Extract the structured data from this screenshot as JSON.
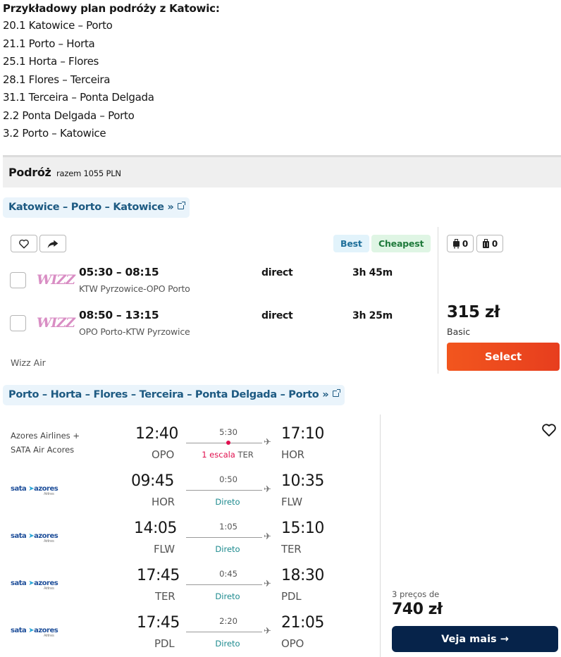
{
  "itinerary": {
    "heading": "Przykładowy plan podróży z Katowic:",
    "lines": [
      "20.1 Katowice – Porto",
      "21.1 Porto – Horta",
      "25.1 Horta – Flores",
      "28.1 Flores – Terceira",
      "31.1 Terceira – Ponta Delgada",
      "2.2 Ponta Delgada – Porto",
      "3.2 Porto – Katowice"
    ]
  },
  "trip": {
    "title": "Podróż",
    "total": "razem 1055 PLN"
  },
  "route1": {
    "link": "Katowice – Porto – Katowice »",
    "badges": {
      "best": "Best",
      "cheapest": "Cheapest"
    },
    "flights": [
      {
        "airline_logo": "WIZZ",
        "times": "05:30 – 08:15",
        "airports": "KTW Pyrzowice-OPO Porto",
        "stops": "direct",
        "duration": "3h 45m"
      },
      {
        "airline_logo": "WIZZ",
        "times": "08:50 – 13:15",
        "airports": "OPO Porto-KTW Pyrzowice",
        "stops": "direct",
        "duration": "3h 25m"
      }
    ],
    "carrier": "Wizz Air",
    "bags": {
      "cabin": "0",
      "checked": "0"
    },
    "price": "315 zł",
    "fare": "Basic",
    "select_label": "Select"
  },
  "route2": {
    "link": "Porto – Horta – Flores – Terceira – Ponta Delgada – Porto »",
    "first_carrier": [
      "Azores Airlines +",
      "SATA Air Acores"
    ],
    "logo_text": "sata",
    "logo_text2": "azores",
    "logo_sub": "Airlines",
    "legs": [
      {
        "dep": "12:40",
        "dep_code": "OPO",
        "dur": "5:30",
        "arr": "17:10",
        "arr_code": "HOR",
        "stop_count": "1 escala",
        "stop_code": "TER"
      },
      {
        "dep": "09:45",
        "dep_code": "HOR",
        "dur": "0:50",
        "arr": "10:35",
        "arr_code": "FLW",
        "stop": "Direto"
      },
      {
        "dep": "14:05",
        "dep_code": "FLW",
        "dur": "1:05",
        "arr": "15:10",
        "arr_code": "TER",
        "stop": "Direto"
      },
      {
        "dep": "17:45",
        "dep_code": "TER",
        "dur": "0:45",
        "arr": "18:30",
        "arr_code": "PDL",
        "stop": "Direto"
      },
      {
        "dep": "17:45",
        "dep_code": "PDL",
        "dur": "2:20",
        "arr": "21:05",
        "arr_code": "OPO",
        "stop": "Direto"
      }
    ],
    "price_count": "3 preços de",
    "price": "740 zł",
    "more_label": "Veja mais →"
  }
}
